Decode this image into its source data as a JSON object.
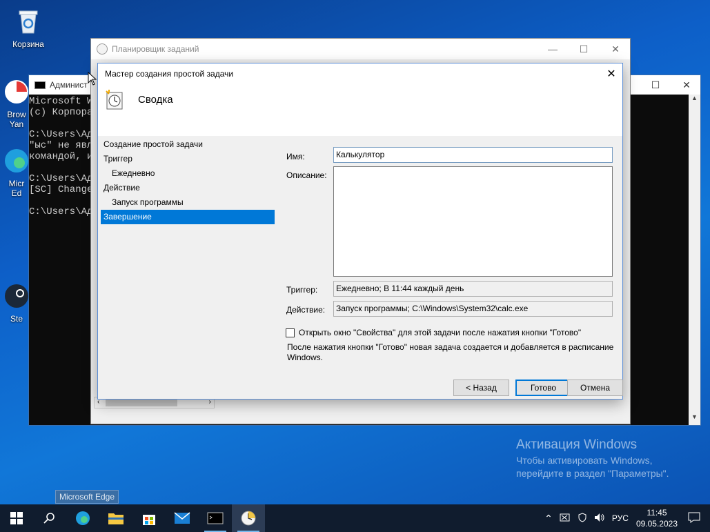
{
  "desktop": {
    "icons": [
      {
        "label": "Корзина"
      },
      {
        "label": "Brow\nYan"
      },
      {
        "label": "Micr\nEd"
      },
      {
        "label": "Ste"
      }
    ]
  },
  "cmd": {
    "title": "Админист",
    "lines": "Microsoft W\n(c) Корпора\n\nC:\\Users\\Ад\n\"ыс\" не явл\nкомандой, и\n\nC:\\Users\\Ад\n[SC] Change\n\nC:\\Users\\Ад"
  },
  "scheduler": {
    "title": "Планировщик заданий"
  },
  "wizard": {
    "title": "Мастер создания простой задачи",
    "header_title": "Сводка",
    "steps": [
      {
        "label": "Создание простой задачи"
      },
      {
        "label": "Триггер"
      },
      {
        "label": "Ежедневно"
      },
      {
        "label": "Действие"
      },
      {
        "label": "Запуск программы"
      },
      {
        "label": "Завершение"
      }
    ],
    "name_label": "Имя:",
    "name_value": "Калькулятор",
    "description_label": "Описание:",
    "description_value": "",
    "trigger_label": "Триггер:",
    "trigger_value": "Ежедневно; В 11:44 каждый день",
    "action_label": "Действие:",
    "action_value": "Запуск программы; C:\\Windows\\System32\\calc.exe",
    "open_properties_label": "Открыть окно \"Свойства\" для этой задачи после нажатия кнопки \"Готово\"",
    "open_properties_checked": false,
    "note": "После нажатия кнопки \"Готово\" новая задача создается и добавляется в расписание Windows.",
    "back_button": "< Назад",
    "finish_button": "Готово",
    "cancel_button": "Отмена"
  },
  "activation": {
    "title": "Активация Windows",
    "line1": "Чтобы активировать Windows,",
    "line2": "перейдите в раздел \"Параметры\"."
  },
  "tooltip": "Microsoft Edge",
  "taskbar": {
    "language": "РУС",
    "time": "11:45",
    "date": "09.05.2023"
  },
  "colors": {
    "accent": "#0078d7",
    "taskbar": "#101c2e",
    "desktop": "#0d5fc8"
  }
}
